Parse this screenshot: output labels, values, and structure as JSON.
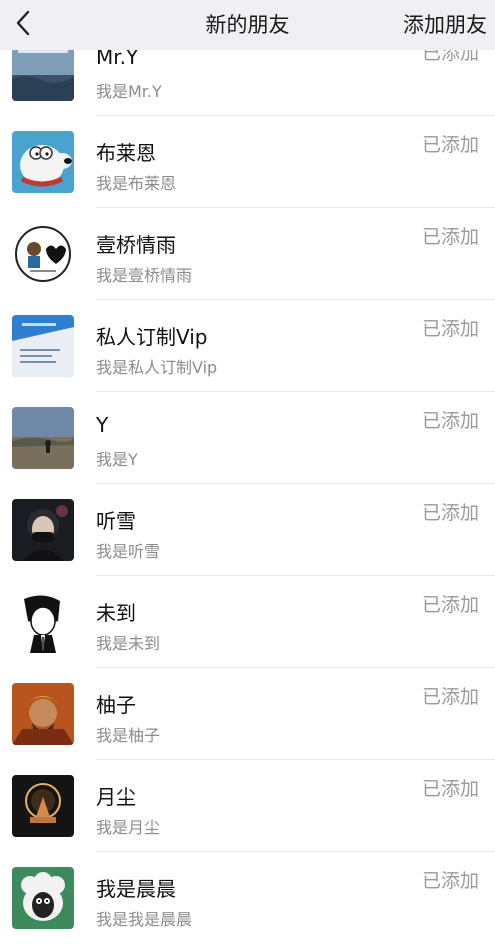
{
  "header": {
    "title": "新的朋友",
    "right_action": "添加朋友",
    "back_icon": "chevron-left-icon"
  },
  "friends": [
    {
      "name": "Mr.Y",
      "subtitle": "我是Mr.Y",
      "status": "已添加"
    },
    {
      "name": "布莱恩",
      "subtitle": "我是布莱恩",
      "status": "已添加"
    },
    {
      "name": "壹桥情雨",
      "subtitle": "我是壹桥情雨",
      "status": "已添加"
    },
    {
      "name": "私人订制Vip",
      "subtitle": "我是私人订制Vip",
      "status": "已添加"
    },
    {
      "name": "Y",
      "subtitle": "我是Y",
      "status": "已添加"
    },
    {
      "name": "听雪",
      "subtitle": "我是听雪",
      "status": "已添加"
    },
    {
      "name": "未到",
      "subtitle": "我是未到",
      "status": "已添加"
    },
    {
      "name": "柚子",
      "subtitle": "我是柚子",
      "status": "已添加"
    },
    {
      "name": "月尘",
      "subtitle": "我是月尘",
      "status": "已添加"
    },
    {
      "name": "我是晨晨",
      "subtitle": "我是我是晨晨",
      "status": "已添加"
    }
  ]
}
